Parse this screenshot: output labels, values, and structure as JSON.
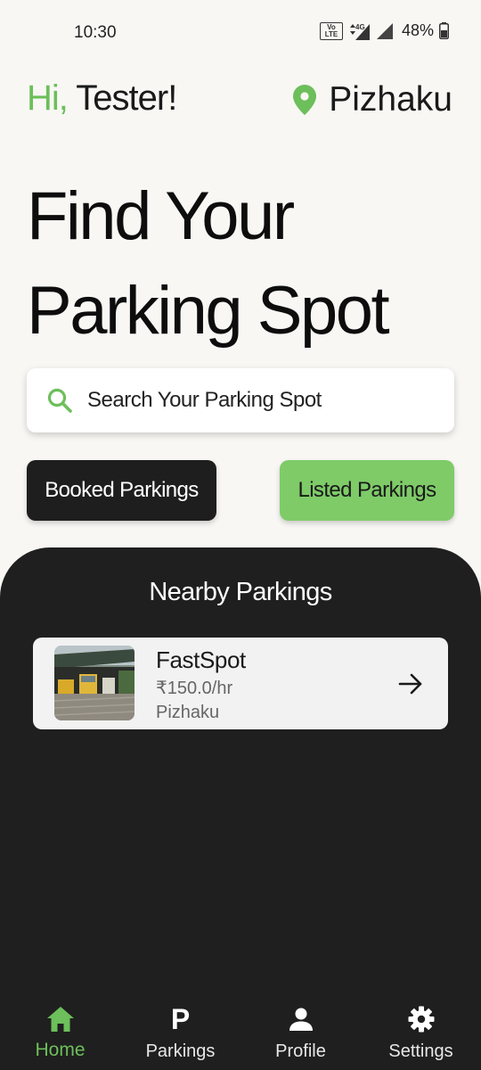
{
  "status_bar": {
    "time": "10:30",
    "volte_top": "Vo",
    "volte_bottom": "LTE",
    "network": "4G",
    "battery": "48%"
  },
  "header": {
    "greeting_hi": "Hi,",
    "greeting_name": " Tester!",
    "location": "Pizhaku"
  },
  "hero": {
    "line1": "Find Your",
    "line2": "Parking Spot"
  },
  "search": {
    "placeholder": "Search Your Parking Spot"
  },
  "actions": {
    "booked": "Booked Parkings",
    "listed": "Listed Parkings"
  },
  "nearby": {
    "title": "Nearby Parkings",
    "items": [
      {
        "name": "FastSpot",
        "price": "₹150.0/hr",
        "location": "Pizhaku"
      }
    ]
  },
  "nav": {
    "items": [
      {
        "label": "Home",
        "icon": "home-icon",
        "active": true
      },
      {
        "label": "Parkings",
        "icon": "parking-icon",
        "active": false
      },
      {
        "label": "Profile",
        "icon": "person-icon",
        "active": false
      },
      {
        "label": "Settings",
        "icon": "gear-icon",
        "active": false
      }
    ]
  },
  "colors": {
    "accent": "#6cbf5a",
    "listed_button": "#7ecb68",
    "dark": "#1f1f1f",
    "background": "#f8f7f4"
  }
}
